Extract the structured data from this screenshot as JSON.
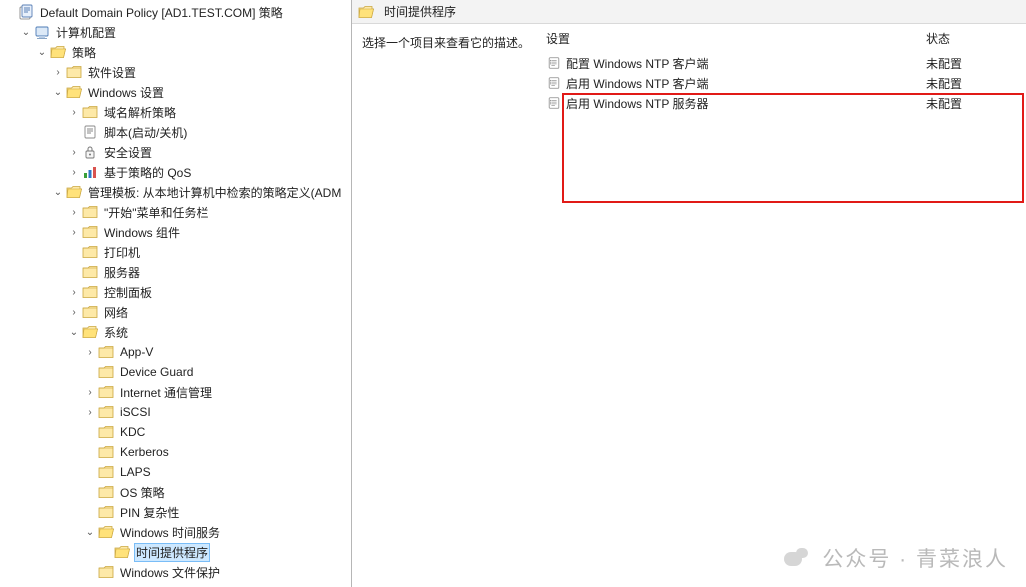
{
  "tree": {
    "root": {
      "label": "Default Domain Policy [AD1.TEST.COM] 策略"
    },
    "computer_config": {
      "label": "计算机配置"
    },
    "policies": {
      "label": "策略"
    },
    "software_settings": {
      "label": "软件设置"
    },
    "windows_settings": {
      "label": "Windows 设置"
    },
    "name_resolution": {
      "label": "域名解析策略"
    },
    "scripts": {
      "label": "脚本(启动/关机)"
    },
    "security": {
      "label": "安全设置"
    },
    "qos": {
      "label": "基于策略的 QoS"
    },
    "admin_templates": {
      "label": "管理模板: 从本地计算机中检索的策略定义(ADM"
    },
    "start_taskbar": {
      "label": "\"开始\"菜单和任务栏"
    },
    "windows_components": {
      "label": "Windows 组件"
    },
    "printers": {
      "label": "打印机"
    },
    "servers": {
      "label": "服务器"
    },
    "control_panel": {
      "label": "控制面板"
    },
    "network": {
      "label": "网络"
    },
    "system": {
      "label": "系统"
    },
    "appv": {
      "label": "App-V"
    },
    "device_guard": {
      "label": "Device Guard"
    },
    "internet_comm": {
      "label": "Internet 通信管理"
    },
    "iscsi": {
      "label": "iSCSI"
    },
    "kdc": {
      "label": "KDC"
    },
    "kerberos": {
      "label": "Kerberos"
    },
    "laps": {
      "label": "LAPS"
    },
    "os_policy": {
      "label": "OS 策略"
    },
    "pin_complexity": {
      "label": "PIN 复杂性"
    },
    "time_service": {
      "label": "Windows 时间服务"
    },
    "time_providers": {
      "label": "时间提供程序"
    },
    "file_protect": {
      "label": "Windows 文件保护"
    }
  },
  "right": {
    "title": "时间提供程序",
    "description": "选择一个项目来查看它的描述。",
    "col_setting": "设置",
    "col_state": "状态",
    "items": [
      {
        "name": "配置 Windows NTP 客户端",
        "state": "未配置"
      },
      {
        "name": "启用 Windows NTP 客户端",
        "state": "未配置"
      },
      {
        "name": "启用 Windows NTP 服务器",
        "state": "未配置"
      }
    ]
  },
  "watermark": {
    "text": "公众号 · 青菜浪人"
  }
}
